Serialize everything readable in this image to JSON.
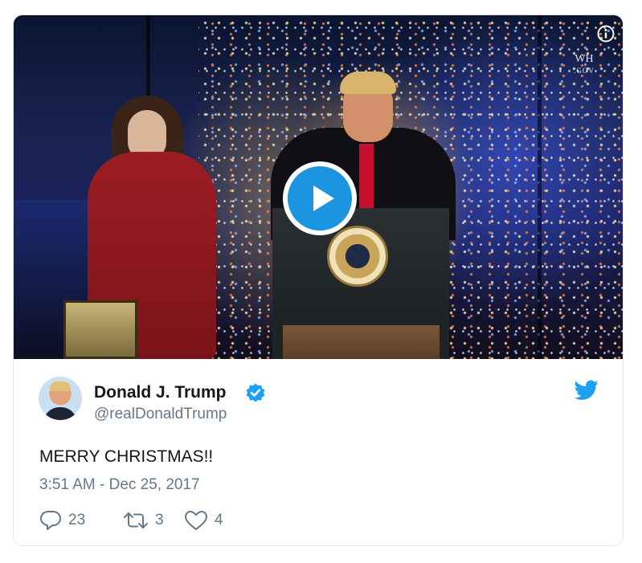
{
  "tweet": {
    "display_name": "Donald J. Trump",
    "screen_name": "@realDonaldTrump",
    "text": "MERRY CHRISTMAS!!",
    "timestamp": "3:51 AM - Dec 25, 2017",
    "verified": true
  },
  "media": {
    "type": "video",
    "watermark_top": "WH",
    "watermark_bottom": ".GOV"
  },
  "actions": {
    "reply_count": "23",
    "retweet_count": "3",
    "like_count": "4"
  },
  "icons": {
    "info": "info-icon",
    "play": "play-icon",
    "verified": "verified-badge-icon",
    "brand": "twitter-bird-icon",
    "reply": "reply-icon",
    "retweet": "retweet-icon",
    "like": "heart-icon"
  },
  "colors": {
    "brand_blue": "#1b95e0",
    "verified_blue": "#1da1f2",
    "secondary_text": "#657786",
    "primary_text": "#14171a",
    "border": "#e1e8ed"
  }
}
